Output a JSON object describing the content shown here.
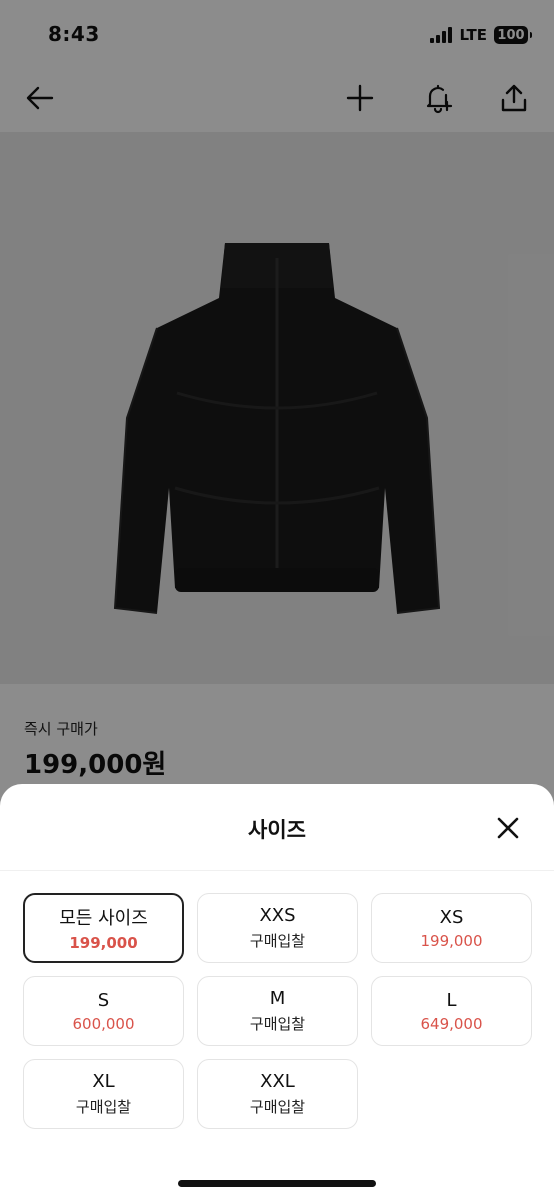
{
  "status_bar": {
    "time": "8:43",
    "network": "LTE",
    "battery": "100"
  },
  "nav": {
    "back_icon": "arrow-left-icon",
    "add_icon": "plus-icon",
    "notify_icon": "bell-plus-icon",
    "share_icon": "share-icon"
  },
  "product": {
    "image_icon": "black-puffer-jacket",
    "price_label": "즉시 구매가",
    "price_value": "199,000원"
  },
  "sheet": {
    "title": "사이즈",
    "close_icon": "close-icon",
    "sizes": [
      {
        "name": "모든 사이즈",
        "price": "199,000",
        "selected": true
      },
      {
        "name": "XXS",
        "price": "구매입찰"
      },
      {
        "name": "XS",
        "price": "199,000"
      },
      {
        "name": "S",
        "price": "600,000"
      },
      {
        "name": "M",
        "price": "구매입찰"
      },
      {
        "name": "L",
        "price": "649,000"
      },
      {
        "name": "XL",
        "price": "구매입찰"
      },
      {
        "name": "XXL",
        "price": "구매입찰"
      }
    ]
  },
  "colors": {
    "price_accent": "#d9534a",
    "selected_border": "#222222",
    "overlay": "rgba(0,0,0,0.45)"
  }
}
